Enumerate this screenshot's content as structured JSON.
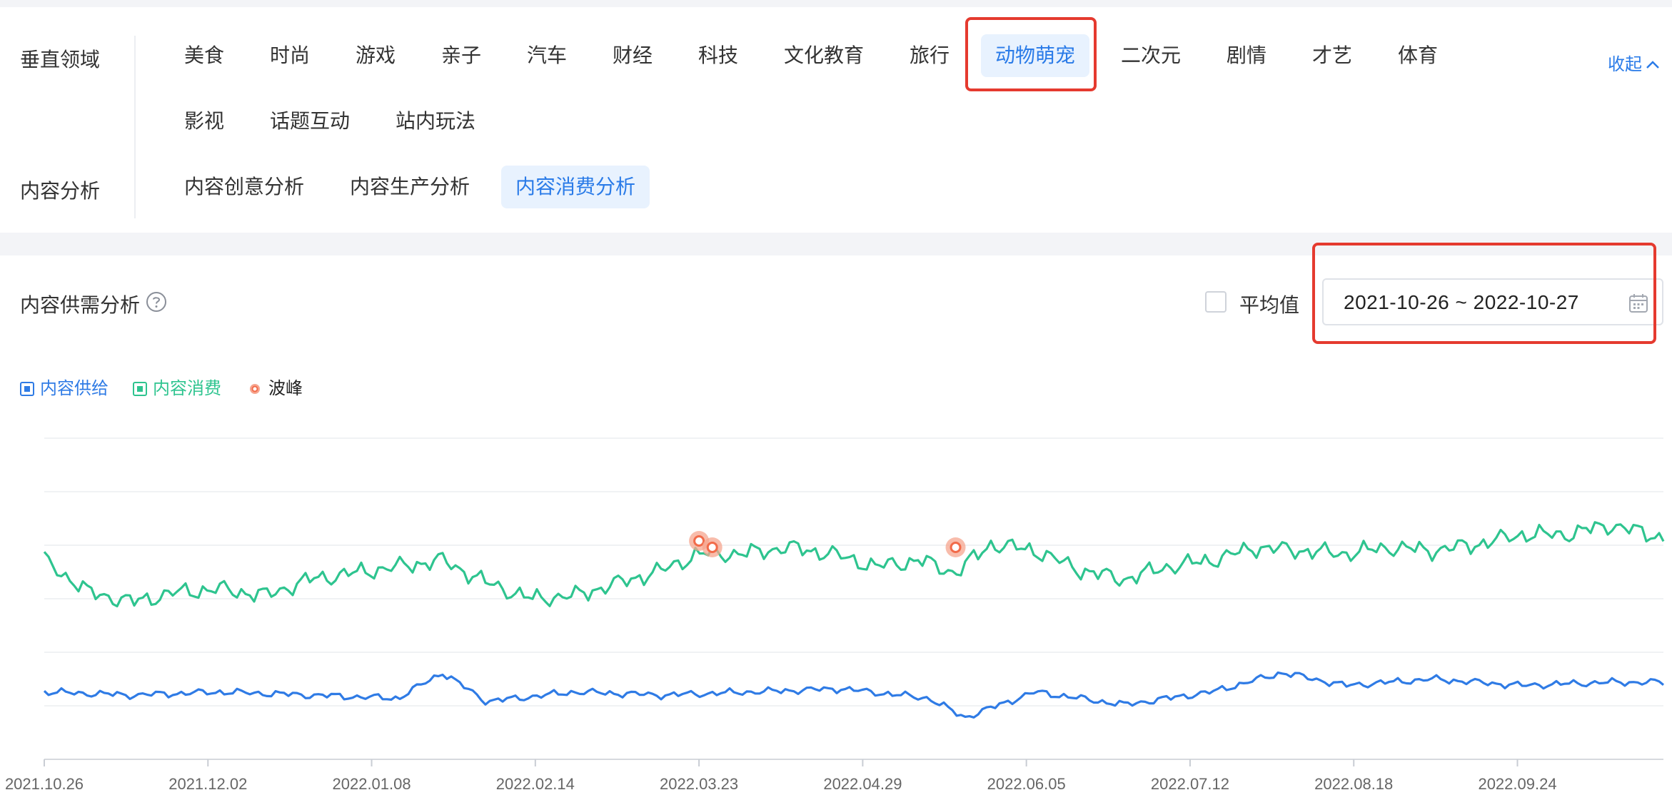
{
  "filters": {
    "vertical_label": "垂直领域",
    "vertical_items": [
      "美食",
      "时尚",
      "游戏",
      "亲子",
      "汽车",
      "财经",
      "科技",
      "文化教育",
      "旅行",
      "动物萌宠",
      "二次元",
      "剧情",
      "才艺",
      "体育"
    ],
    "vertical_items_row2": [
      "影视",
      "话题互动",
      "站内玩法"
    ],
    "vertical_active": "动物萌宠",
    "collapse_label": "收起",
    "content_label": "内容分析",
    "content_items": [
      "内容创意分析",
      "内容生产分析",
      "内容消费分析"
    ],
    "content_active": "内容消费分析"
  },
  "analysis": {
    "title": "内容供需分析",
    "average_label": "平均值",
    "average_checked": false,
    "date_range": "2021-10-26 ~ 2022-10-27"
  },
  "icons": {
    "help": "question-circle-icon",
    "calendar": "calendar-icon",
    "collapse": "chevron-up-icon",
    "peak": "peak-marker-icon"
  },
  "colors": {
    "accent": "#2a7be8",
    "supply": "#2f7be5",
    "consumption": "#2ec48f",
    "peak": "#f26b4a",
    "highlight": "#e53a2f"
  },
  "chart_data": {
    "type": "line",
    "legend": [
      "内容供给",
      "内容消费",
      "波峰"
    ],
    "x_tick_labels": [
      "2021.10.26",
      "2021.12.02",
      "2022.01.08",
      "2022.02.14",
      "2022.03.23",
      "2022.04.29",
      "2022.06.05",
      "2022.07.12",
      "2022.08.18",
      "2022.09.24"
    ],
    "x_range": [
      "2021-10-26",
      "2022-10-27"
    ],
    "grid": true,
    "y_axis_visible": false,
    "series": [
      {
        "name": "内容消费",
        "description_points": [
          [
            "2021-10-26",
            0.62
          ],
          [
            "2021-11-05",
            0.52
          ],
          [
            "2021-11-15",
            0.49
          ],
          [
            "2021-11-25",
            0.52
          ],
          [
            "2021-12-05",
            0.53
          ],
          [
            "2021-12-15",
            0.51
          ],
          [
            "2021-12-25",
            0.56
          ],
          [
            "2022-01-04",
            0.58
          ],
          [
            "2022-01-14",
            0.6
          ],
          [
            "2022-01-24",
            0.62
          ],
          [
            "2022-02-03",
            0.55
          ],
          [
            "2022-02-13",
            0.5
          ],
          [
            "2022-02-23",
            0.51
          ],
          [
            "2022-03-05",
            0.55
          ],
          [
            "2022-03-15",
            0.59
          ],
          [
            "2022-03-23",
            0.64
          ],
          [
            "2022-04-02",
            0.64
          ],
          [
            "2022-04-12",
            0.66
          ],
          [
            "2022-04-22",
            0.64
          ],
          [
            "2022-05-02",
            0.6
          ],
          [
            "2022-05-12",
            0.62
          ],
          [
            "2022-05-20",
            0.58
          ],
          [
            "2022-05-28",
            0.67
          ],
          [
            "2022-06-07",
            0.65
          ],
          [
            "2022-06-17",
            0.59
          ],
          [
            "2022-06-27",
            0.56
          ],
          [
            "2022-07-07",
            0.6
          ],
          [
            "2022-07-17",
            0.62
          ],
          [
            "2022-07-27",
            0.66
          ],
          [
            "2022-08-06",
            0.65
          ],
          [
            "2022-08-16",
            0.64
          ],
          [
            "2022-08-26",
            0.66
          ],
          [
            "2022-09-05",
            0.65
          ],
          [
            "2022-09-15",
            0.67
          ],
          [
            "2022-09-25",
            0.7
          ],
          [
            "2022-10-05",
            0.7
          ],
          [
            "2022-10-15",
            0.73
          ],
          [
            "2022-10-27",
            0.69
          ]
        ]
      },
      {
        "name": "内容供给",
        "description_points": [
          [
            "2021-10-26",
            0.21
          ],
          [
            "2021-11-15",
            0.2
          ],
          [
            "2021-12-05",
            0.21
          ],
          [
            "2021-12-25",
            0.2
          ],
          [
            "2022-01-14",
            0.19
          ],
          [
            "2022-01-24",
            0.27
          ],
          [
            "2022-02-03",
            0.18
          ],
          [
            "2022-02-23",
            0.21
          ],
          [
            "2022-03-15",
            0.2
          ],
          [
            "2022-04-04",
            0.21
          ],
          [
            "2022-04-24",
            0.22
          ],
          [
            "2022-05-14",
            0.19
          ],
          [
            "2022-05-22",
            0.13
          ],
          [
            "2022-06-07",
            0.21
          ],
          [
            "2022-06-27",
            0.17
          ],
          [
            "2022-07-17",
            0.21
          ],
          [
            "2022-08-02",
            0.27
          ],
          [
            "2022-08-16",
            0.23
          ],
          [
            "2022-09-05",
            0.25
          ],
          [
            "2022-09-25",
            0.23
          ],
          [
            "2022-10-15",
            0.24
          ],
          [
            "2022-10-27",
            0.24
          ]
        ]
      }
    ],
    "peaks": [
      {
        "series": "内容消费",
        "date": "2022-03-23",
        "value": 0.68
      },
      {
        "series": "内容消费",
        "date": "2022-03-26",
        "value": 0.66
      },
      {
        "series": "内容消费",
        "date": "2022-05-20",
        "value": 0.66
      }
    ]
  }
}
